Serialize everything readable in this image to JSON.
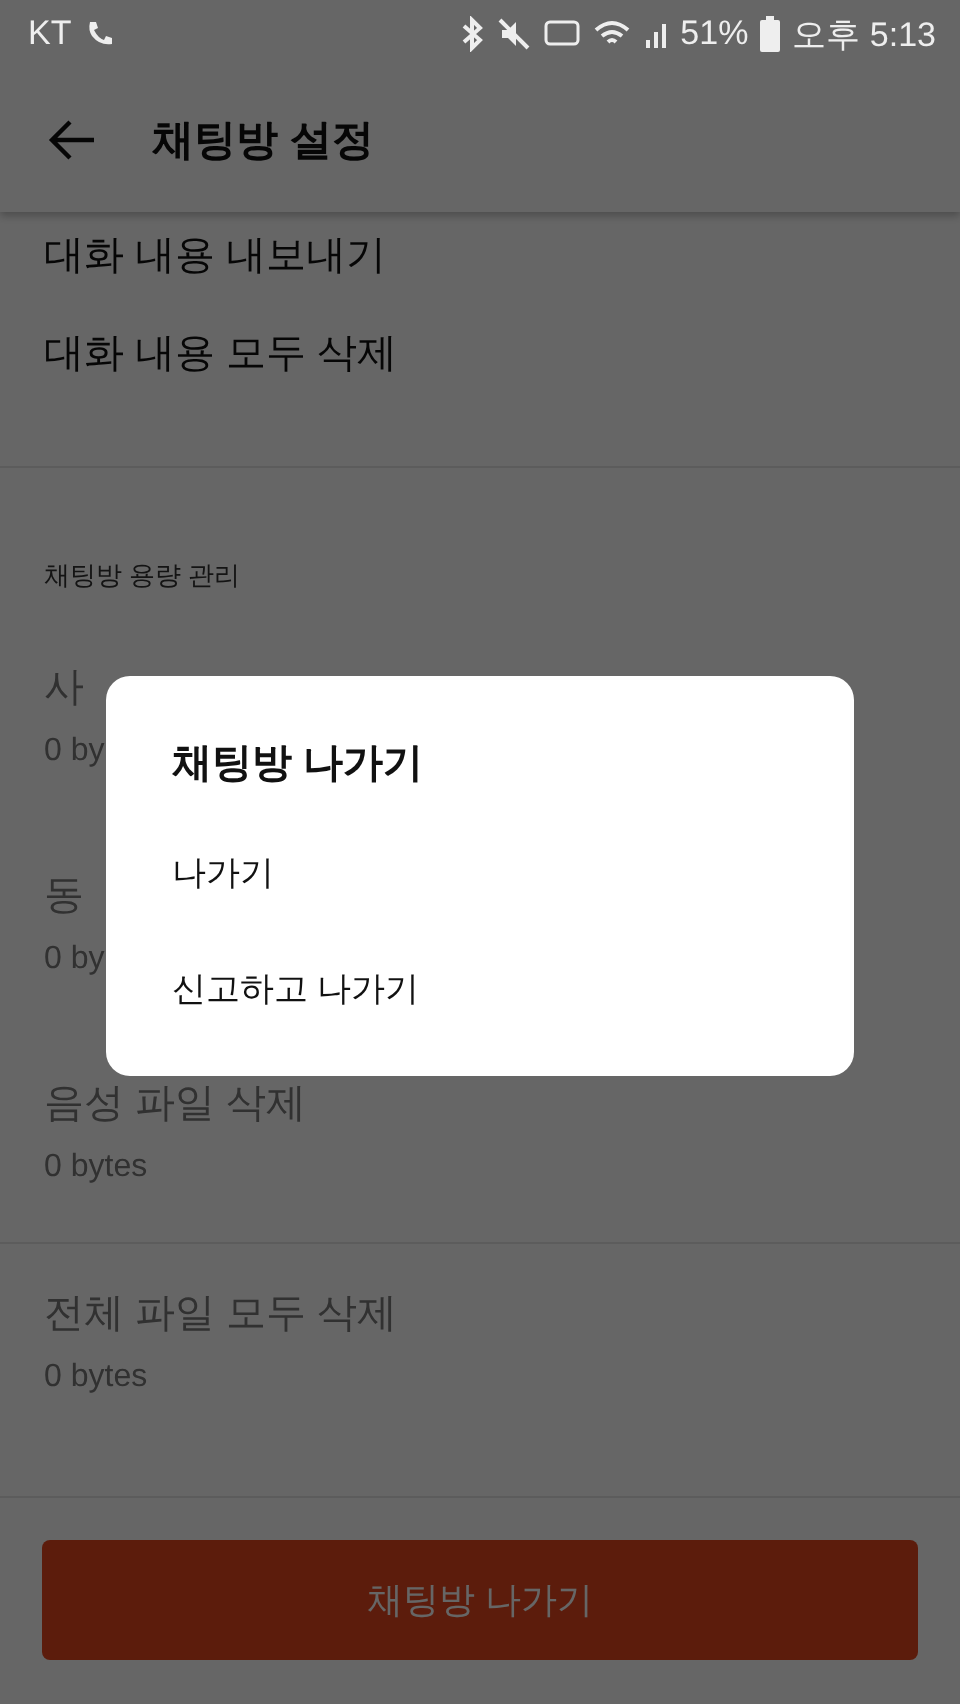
{
  "status_bar": {
    "carrier": "KT",
    "battery": "51%",
    "time": "오후 5:13"
  },
  "header": {
    "title": "채팅방 설정"
  },
  "chat_items": [
    {
      "label": "대화 내용 내보내기",
      "disabled": false
    },
    {
      "label": "대화 내용 모두 삭제",
      "disabled": false
    }
  ],
  "storage": {
    "heading": "채팅방 용량 관리",
    "items": [
      {
        "label": "사",
        "size": "0 by",
        "disabled": true,
        "separated": false
      },
      {
        "label": "동",
        "size": "0 by",
        "disabled": true,
        "separated": false
      },
      {
        "label": "음성 파일 삭제",
        "size": "0 bytes",
        "disabled": true,
        "separated": false
      },
      {
        "label": "전체 파일 모두 삭제",
        "size": "0 bytes",
        "disabled": true,
        "separated": true
      }
    ]
  },
  "leave_button": "채팅방 나가기",
  "dialog": {
    "title": "채팅방 나가기",
    "options": [
      "나가기",
      "신고하고 나가기"
    ]
  }
}
